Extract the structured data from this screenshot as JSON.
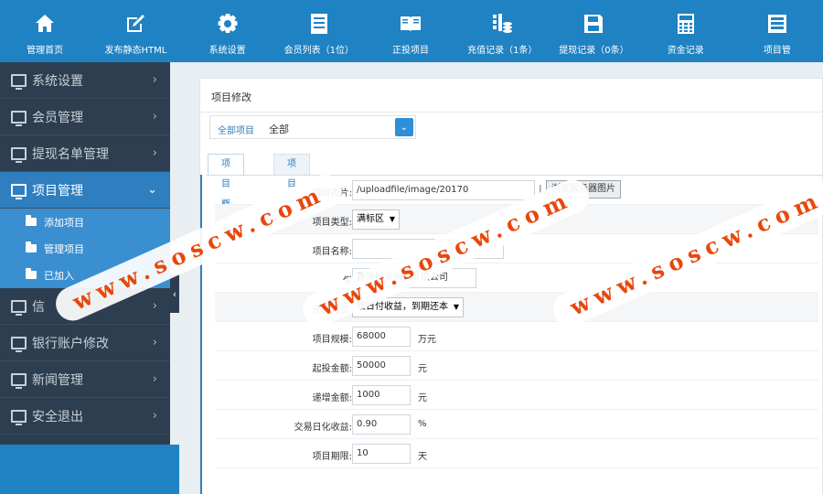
{
  "topnav": [
    {
      "label": "管理首页",
      "icon": "home-icon"
    },
    {
      "label": "发布静态HTML",
      "icon": "edit-icon"
    },
    {
      "label": "系统设置",
      "icon": "gear-icon"
    },
    {
      "label": "会员列表（1位）",
      "icon": "document-icon"
    },
    {
      "label": "正投项目",
      "icon": "book-icon"
    },
    {
      "label": "充值记录（1条）",
      "icon": "coins-icon"
    },
    {
      "label": "提现记录（0条）",
      "icon": "save-icon"
    },
    {
      "label": "资金记录",
      "icon": "calculator-icon"
    },
    {
      "label": "项目管",
      "icon": "list-icon"
    }
  ],
  "sidebar": {
    "items": [
      {
        "label": "系统设置"
      },
      {
        "label": "会员管理"
      },
      {
        "label": "提现名单管理"
      },
      {
        "label": "项目管理",
        "active": true
      }
    ],
    "sub_items": [
      {
        "label": "添加项目"
      },
      {
        "label": "管理项目"
      },
      {
        "label": "已加入"
      }
    ],
    "items_after": [
      {
        "label": "信"
      },
      {
        "label": "银行账户修改"
      },
      {
        "label": "新闻管理"
      },
      {
        "label": "安全退出"
      }
    ],
    "collapse_glyph": "‹"
  },
  "panel": {
    "title": "项目修改",
    "filter_key": "全部项目",
    "filter_value": "全部"
  },
  "tabs": [
    {
      "label": "项目概况",
      "active": true
    },
    {
      "label": "项目参数",
      "active": false
    }
  ],
  "form": {
    "image": {
      "label": "项目图片:",
      "value": "/uploadfile/image/20170",
      "browse": "浏览服务器图片",
      "pipe": "|"
    },
    "type": {
      "label": "项目类型:",
      "value": "满标区"
    },
    "name": {
      "label": "项目名称:",
      "value": ""
    },
    "guarantee": {
      "label": "保",
      "value": "鑫泽投资担保有限公司"
    },
    "repay": {
      "label": "还款方式:",
      "value": "按日付收益，到期还本"
    },
    "scale": {
      "label": "项目规模:",
      "value": "68000",
      "unit": "万元"
    },
    "min_invest": {
      "label": "起投金额:",
      "value": "50000",
      "unit": "元"
    },
    "step": {
      "label": "递增金额:",
      "value": "1000",
      "unit": "元"
    },
    "daily_rate": {
      "label": "交易日化收益:",
      "value": "0.90",
      "unit": "%"
    },
    "period": {
      "label": "项目期限:",
      "value": "10",
      "unit": "天"
    }
  },
  "watermark": "www.soscw.com",
  "colors": {
    "topbar": "#1f82c3",
    "sidebar": "#2d3e50",
    "sidebar_active": "#2f7ec0",
    "watermark": "#e8470b"
  }
}
